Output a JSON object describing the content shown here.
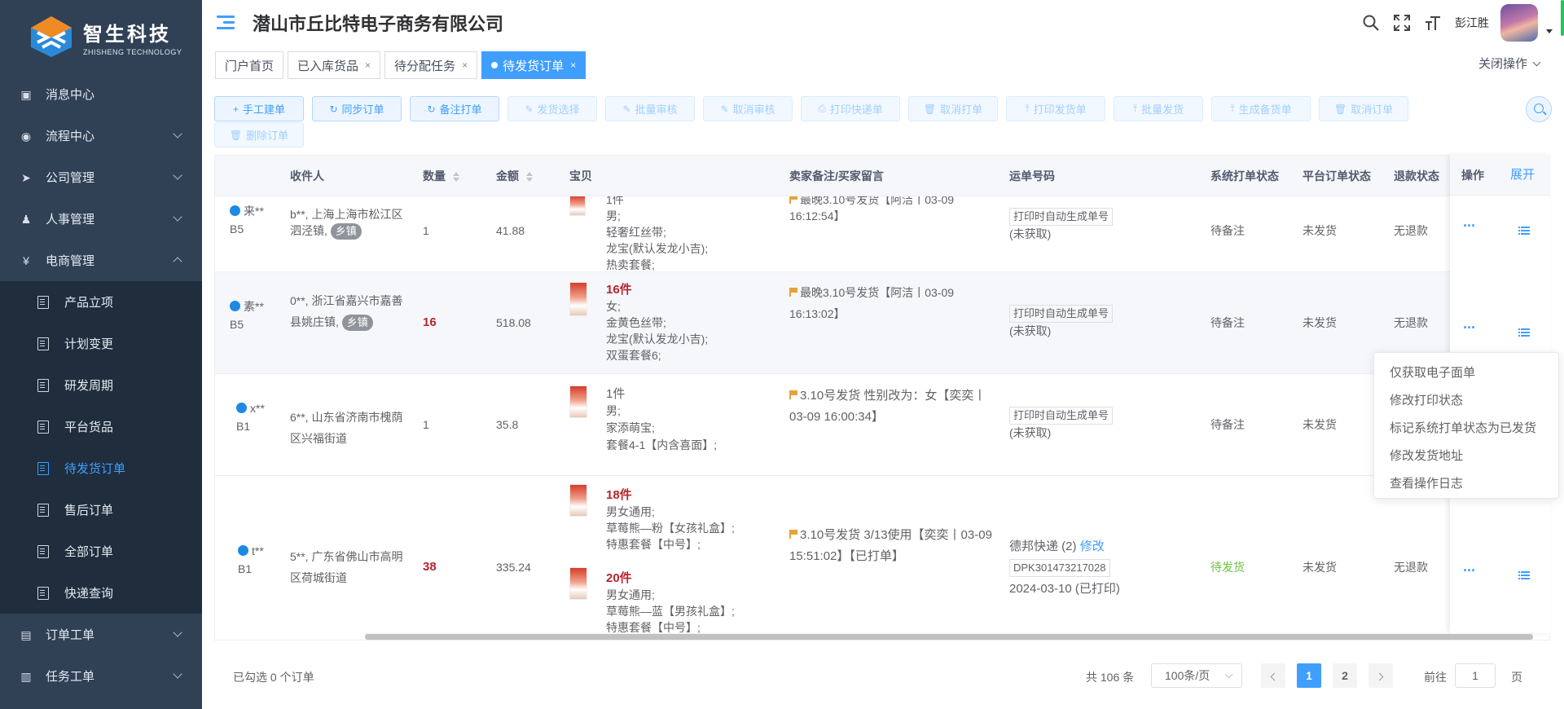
{
  "brand": {
    "name_cn": "智生科技",
    "name_en": "ZHISHENG TECHNOLOGY"
  },
  "sidebar": {
    "items": [
      {
        "label": "消息中心",
        "icon": "message-icon",
        "expandable": false
      },
      {
        "label": "流程中心",
        "icon": "flow-icon",
        "expandable": true
      },
      {
        "label": "公司管理",
        "icon": "send-icon",
        "expandable": true
      },
      {
        "label": "人事管理",
        "icon": "people-icon",
        "expandable": true
      },
      {
        "label": "电商管理",
        "icon": "yen-icon",
        "expandable": true,
        "open": true
      },
      {
        "label": "订单工单",
        "icon": "order-icon",
        "expandable": true
      },
      {
        "label": "任务工单",
        "icon": "task-icon",
        "expandable": true
      }
    ],
    "sub_items": [
      {
        "label": "产品立项"
      },
      {
        "label": "计划变更"
      },
      {
        "label": "研发周期"
      },
      {
        "label": "平台货品"
      },
      {
        "label": "待发货订单",
        "active": true
      },
      {
        "label": "售后订单"
      },
      {
        "label": "全部订单"
      },
      {
        "label": "快递查询"
      }
    ]
  },
  "header": {
    "company": "潜山市丘比特电子商务有限公司",
    "username": "彭江胜"
  },
  "tags": {
    "items": [
      {
        "label": "门户首页",
        "closable": false
      },
      {
        "label": "已入库货品",
        "closable": true
      },
      {
        "label": "待分配任务",
        "closable": true
      },
      {
        "label": "待发货订单",
        "closable": true,
        "active": true
      }
    ],
    "close_ops": "关闭操作"
  },
  "toolbar": {
    "buttons": [
      {
        "label": "手工建单",
        "icon": "+",
        "disabled": false
      },
      {
        "label": "同步订单",
        "icon": "↻",
        "disabled": false
      },
      {
        "label": "备注打单",
        "icon": "↻",
        "disabled": false
      },
      {
        "label": "发货选择",
        "icon": "✎",
        "disabled": true
      },
      {
        "label": "批量审核",
        "icon": "✎",
        "disabled": true
      },
      {
        "label": "取消审核",
        "icon": "✎",
        "disabled": true
      },
      {
        "label": "打印快递单",
        "icon": "⎙",
        "disabled": true
      },
      {
        "label": "取消打单",
        "icon": "🗑",
        "disabled": true
      },
      {
        "label": "打印发货单",
        "icon": "⤒",
        "disabled": true
      },
      {
        "label": "批量发货",
        "icon": "⤒",
        "disabled": true
      },
      {
        "label": "生成备货单",
        "icon": "⤒",
        "disabled": true
      },
      {
        "label": "取消订单",
        "icon": "🗑",
        "disabled": true
      },
      {
        "label": "删除订单",
        "icon": "🗑",
        "disabled": true
      }
    ]
  },
  "table": {
    "headers": {
      "receiver": "收件人",
      "qty": "数量",
      "amount": "金额",
      "item": "宝贝",
      "remark": "卖家备注/买家留言",
      "waybill": "运单号码",
      "sys_status": "系统打单状态",
      "plat_status": "平台订单状态",
      "refund": "退款状态",
      "ops": "操作",
      "expand": "展开"
    },
    "rows": [
      {
        "buyer": "来**",
        "level": "B5",
        "receiver": "b**, 上海上海市松江区泗泾镇,",
        "town": "乡镇",
        "qty": "1",
        "qty_highlight": false,
        "amount": "41.88",
        "item_lines": [
          "1件",
          "男;",
          "轻奢红丝带;",
          "龙宝(默认发龙小吉);",
          "热卖套餐;"
        ],
        "remark": "最晚3.10号发货【阿洁丨03-09 16:12:54】",
        "waybill_box": "打印时自动生成单号",
        "waybill_note": "(未获取)",
        "sys_status": "待备注",
        "plat_status": "未发货",
        "refund": "无退款"
      },
      {
        "buyer": "素**",
        "level": "B5",
        "receiver": "0**, 浙江省嘉兴市嘉善县姚庄镇,",
        "town": "乡镇",
        "qty": "16",
        "qty_highlight": true,
        "amount": "518.08",
        "item_title": "16件",
        "item_lines": [
          "女;",
          "金黄色丝带;",
          "龙宝(默认发龙小吉);",
          "双蛋套餐6;"
        ],
        "remark": "最晚3.10号发货【阿洁丨03-09 16:13:02】",
        "waybill_box": "打印时自动生成单号",
        "waybill_note": "(未获取)",
        "sys_status": "待备注",
        "plat_status": "未发货",
        "refund": "无退款"
      },
      {
        "buyer": "x**",
        "level": "B1",
        "receiver": "6**, 山东省济南市槐荫区兴福街道",
        "town": "",
        "qty": "1",
        "qty_highlight": false,
        "amount": "35.8",
        "item_lines": [
          "1件",
          "男;",
          "家添萌宝;",
          "套餐4-1【内含喜面】;"
        ],
        "remark": "3.10号发货 性别改为：女【奕奕丨03-09 16:00:34】",
        "waybill_box": "打印时自动生成单号",
        "waybill_note": "(未获取)",
        "sys_status": "待备注",
        "plat_status": "未发货",
        "refund": "无退款"
      },
      {
        "buyer": "t**",
        "level": "B1",
        "receiver": "5**, 广东省佛山市高明区荷城街道",
        "town": "",
        "qty": "38",
        "qty_highlight": true,
        "amount": "335.24",
        "item_title": "18件",
        "item_lines": [
          "男女通用;",
          "草莓熊—粉【女孩礼盒】;",
          "特惠套餐【中号】;"
        ],
        "item2_title": "20件",
        "item2_lines": [
          "男女通用;",
          "草莓熊—蓝【男孩礼盒】;",
          "特惠套餐【中号】;"
        ],
        "remark": "3.10号发货 3/13使用【奕奕丨03-09 15:51:02】【已打单】",
        "courier": "德邦快递 (2)",
        "courier_edit": "修改",
        "waybill_box": "DPK301473217028",
        "waybill_note": "2024-03-10 (已打印)",
        "sys_status": "待发货",
        "plat_status": "未发货",
        "refund": "无退款"
      }
    ]
  },
  "dropdown": {
    "items": [
      "仅获取电子面单",
      "修改打印状态",
      "标记系统打单状态为已发货",
      "修改发货地址",
      "查看操作日志"
    ]
  },
  "footer": {
    "selected": "已勾选 0 个订单",
    "total": "共 106 条",
    "page_size": "100条/页",
    "pages": [
      "1",
      "2"
    ],
    "current_page": "1",
    "goto_prefix": "前往",
    "goto_value": "1",
    "goto_suffix": "页"
  },
  "colors": {
    "primary": "#409eff",
    "sidebar": "#304156",
    "submenu": "#1f2d3d",
    "danger_text": "#b7262e",
    "success": "#67c23a"
  }
}
